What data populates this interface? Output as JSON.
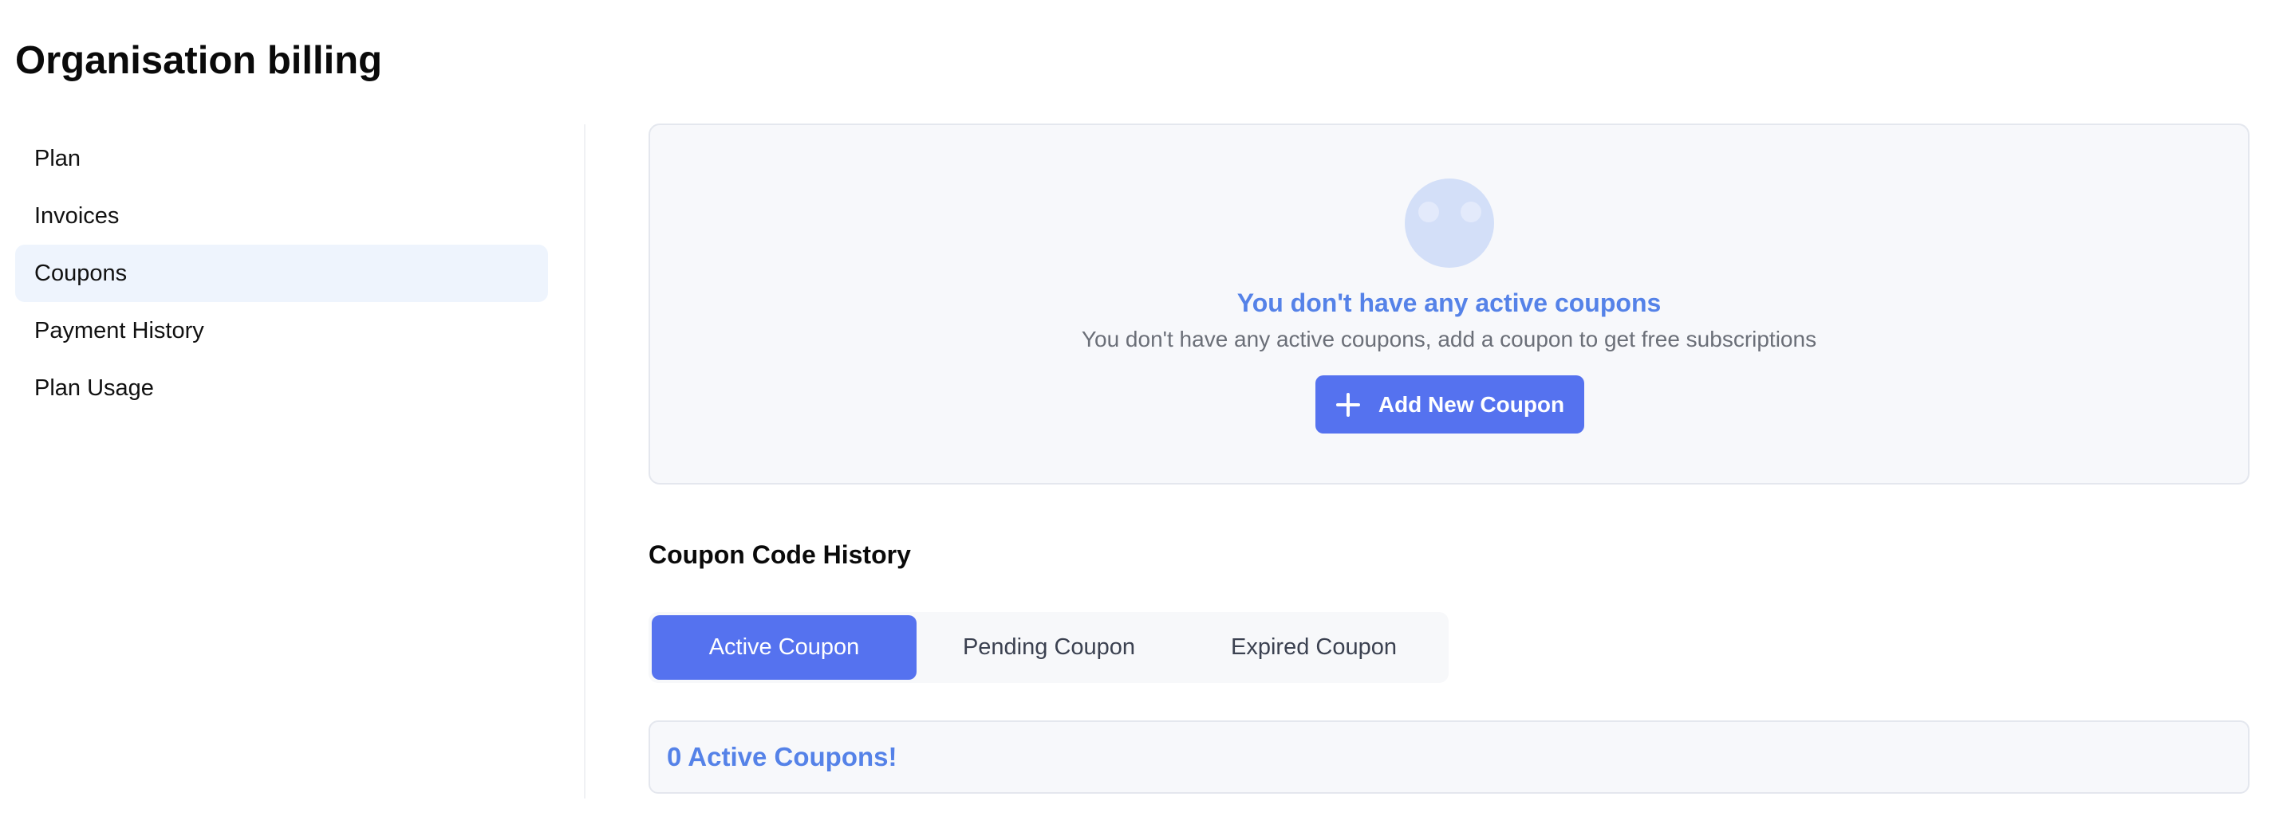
{
  "page": {
    "title": "Organisation billing"
  },
  "sidebar": {
    "items": [
      {
        "label": "Plan",
        "active": false
      },
      {
        "label": "Invoices",
        "active": false
      },
      {
        "label": "Coupons",
        "active": true
      },
      {
        "label": "Payment History",
        "active": false
      },
      {
        "label": "Plan Usage",
        "active": false
      }
    ]
  },
  "empty_state": {
    "icon": "empty-face-icon",
    "title": "You don't have any active coupons",
    "subtitle": "You don't have any active coupons, add a coupon to get free subscriptions",
    "button_label": "Add New Coupon",
    "button_icon": "plus-icon"
  },
  "history": {
    "title": "Coupon Code History",
    "tabs": [
      {
        "label": "Active Coupon",
        "active": true
      },
      {
        "label": "Pending Coupon",
        "active": false
      },
      {
        "label": "Expired Coupon",
        "active": false
      }
    ],
    "status_text": "0 Active Coupons!"
  },
  "colors": {
    "accent": "#5572ef",
    "accent_text": "#5582e8",
    "active_nav_bg": "#eef4fd",
    "card_bg": "#f7f8fb"
  }
}
